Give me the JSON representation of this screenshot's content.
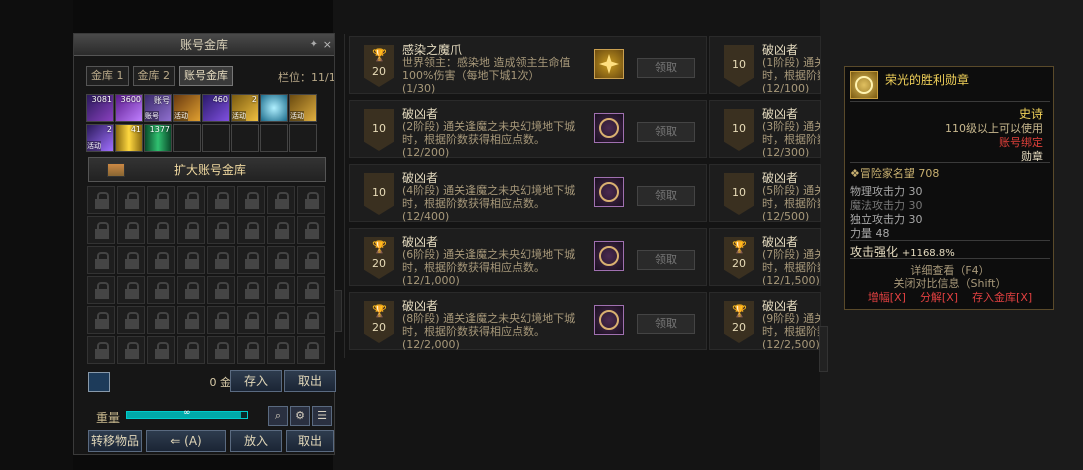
{
  "warehouse": {
    "title": "账号金库",
    "pin": "✦",
    "close": "×",
    "tabs": [
      "金库 1",
      "金库 2",
      "账号金库"
    ],
    "slot_label": "栏位：11/16",
    "items": [
      {
        "count": "3081",
        "tag": ""
      },
      {
        "count": "3600",
        "tag": ""
      },
      {
        "count": "",
        "tag": "账号"
      },
      {
        "count": "",
        "tag": "活动"
      },
      {
        "count": "460",
        "tag": ""
      },
      {
        "count": "2",
        "tag": "活动"
      },
      {
        "count": "",
        "tag": ""
      },
      {
        "count": "",
        "tag": "活动"
      },
      {
        "count": "2",
        "tag": "活动"
      },
      {
        "count": "41",
        "tag": ""
      },
      {
        "count": "1377",
        "tag": ""
      }
    ],
    "item_top_labels": [
      "账号"
    ],
    "expand_label": "扩大账号金库",
    "gold_text": "0 金币",
    "deposit": "存入",
    "withdraw": "取出",
    "weight_label": "重量",
    "weight_value": "∞",
    "weight_fill": 0.95,
    "transfer_label": "转移物品",
    "transfer_mode": "⇐ (A)",
    "put_in": "放入",
    "take_out": "取出"
  },
  "achievements": {
    "claim_label": "领取",
    "left": [
      {
        "title": "感染之魔爪",
        "desc": "世界领主：感染地 造成领主生命值100%伤害（每地下城1次）",
        "progress": "(1/30)",
        "points": "20",
        "trophy": true,
        "icon": "gold"
      },
      {
        "title": "破凶者",
        "desc": "(2阶段) 通关逢魔之未央幻境地下城时，根据阶数获得相应点数。",
        "progress": "(12/200)",
        "points": "10",
        "trophy": false,
        "icon": "purple"
      },
      {
        "title": "破凶者",
        "desc": "(4阶段) 通关逢魔之未央幻境地下城时，根据阶数获得相应点数。",
        "progress": "(12/400)",
        "points": "10",
        "trophy": false,
        "icon": "purple"
      },
      {
        "title": "破凶者",
        "desc": "(6阶段) 通关逢魔之未央幻境地下城时，根据阶数获得相应点数。",
        "progress": "(12/1,000)",
        "points": "20",
        "trophy": true,
        "icon": "purple"
      },
      {
        "title": "破凶者",
        "desc": "(8阶段) 通关逢魔之未央幻境地下城时，根据阶数获得相应点数。",
        "progress": "(12/2,000)",
        "points": "20",
        "trophy": true,
        "icon": "purple"
      }
    ],
    "right": [
      {
        "title": "破凶者",
        "desc": "(1阶段) 通关逢魔之未央幻境地下城时，根据阶数获得相应点数。",
        "progress": "(12/100)",
        "points": "10",
        "trophy": false
      },
      {
        "title": "破凶者",
        "desc": "(3阶段) 通关逢魔之未央幻境地下城时，根据阶数获得相应点数。",
        "progress": "(12/300)",
        "points": "10",
        "trophy": false
      },
      {
        "title": "破凶者",
        "desc": "(5阶段) 通关逢魔之未央幻境地下城时，根据阶数获得相应点数。",
        "progress": "(12/500)",
        "points": "10",
        "trophy": false
      },
      {
        "title": "破凶者",
        "desc": "(7阶段) 通关逢魔之未央幻境地下城时，根据阶数获得相应点数。",
        "progress": "(12/1,500)",
        "points": "20",
        "trophy": true
      },
      {
        "title": "破凶者",
        "desc": "(9阶段) 通关逢魔之未央幻境地下城时，根据阶数获得相应点数。",
        "progress": "(12/2,500)",
        "points": "20",
        "trophy": true
      }
    ]
  },
  "tooltip": {
    "name": "荣光的胜利勋章",
    "rarity": "史诗",
    "level_req": "110级以上可以使用",
    "bind": "账号绑定",
    "type": "勋章",
    "fame_label": "冒险家名望",
    "fame_value": "708",
    "stats": [
      "物理攻击力 30",
      "魔法攻击力 30",
      "独立攻击力 30",
      "力量 48"
    ],
    "enhance_label": "攻击强化",
    "enhance_value": "+1168.8%",
    "detail": "详细查看（F4）",
    "compare": "关闭对比信息（Shift）",
    "act_amplify": "增幅[X]",
    "act_disassemble": "分解[X]",
    "act_store": "存入金库[X]",
    "colors": {
      "name": "#f2d25a",
      "rarity": "#f2d25a",
      "bind": "#e0403a",
      "fame": "#c8b070",
      "act": "#e04040"
    }
  }
}
